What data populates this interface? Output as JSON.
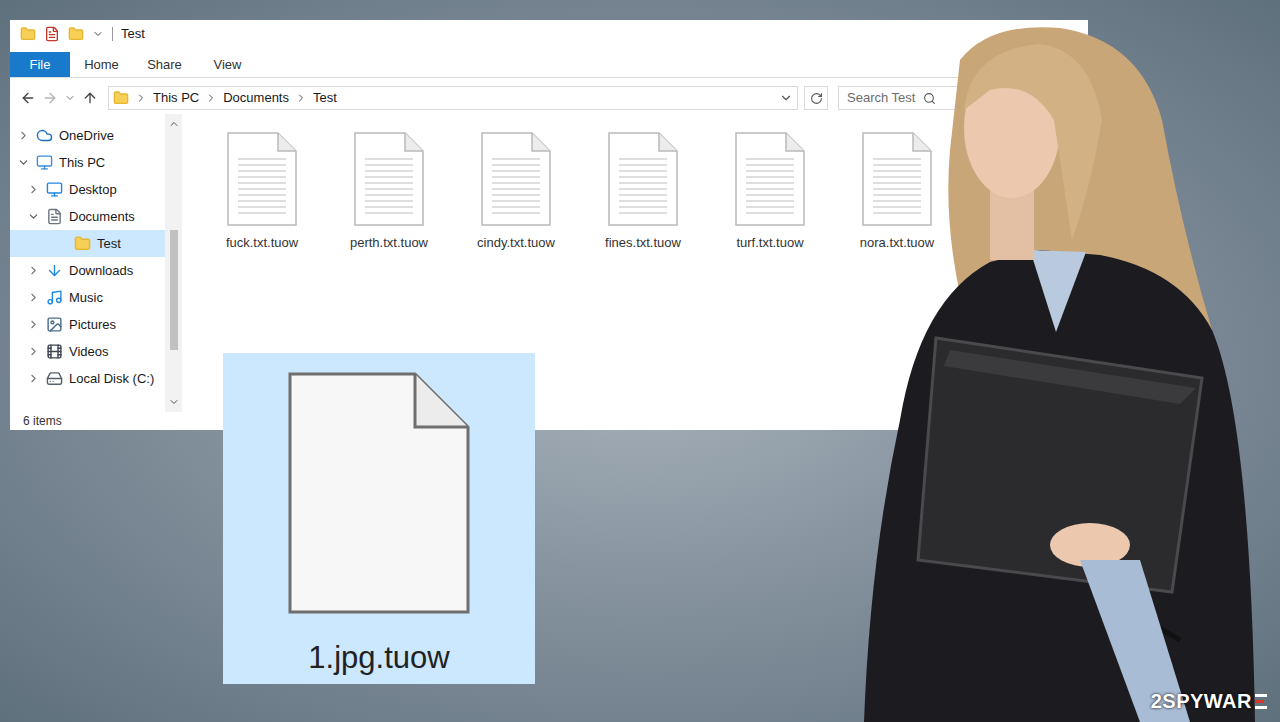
{
  "window": {
    "title": "Test"
  },
  "ribbon_tabs": [
    {
      "label": "File",
      "selected": true
    },
    {
      "label": "Home",
      "selected": false
    },
    {
      "label": "Share",
      "selected": false
    },
    {
      "label": "View",
      "selected": false
    }
  ],
  "address": {
    "crumbs": [
      "This PC",
      "Documents",
      "Test"
    ]
  },
  "search": {
    "placeholder": "Search Test"
  },
  "sidebar": {
    "items": [
      {
        "label": "OneDrive",
        "kind": "onedrive",
        "depth": 0,
        "expandable": true,
        "expanded": false,
        "selected": false
      },
      {
        "label": "This PC",
        "kind": "pc",
        "depth": 0,
        "expandable": true,
        "expanded": true,
        "selected": false
      },
      {
        "label": "Desktop",
        "kind": "desktop",
        "depth": 1,
        "expandable": true,
        "expanded": false,
        "selected": false
      },
      {
        "label": "Documents",
        "kind": "documents",
        "depth": 1,
        "expandable": true,
        "expanded": true,
        "selected": false
      },
      {
        "label": "Test",
        "kind": "folder",
        "depth": 2,
        "expandable": false,
        "expanded": false,
        "selected": true
      },
      {
        "label": "Downloads",
        "kind": "downloads",
        "depth": 1,
        "expandable": true,
        "expanded": false,
        "selected": false
      },
      {
        "label": "Music",
        "kind": "music",
        "depth": 1,
        "expandable": true,
        "expanded": false,
        "selected": false
      },
      {
        "label": "Pictures",
        "kind": "pictures",
        "depth": 1,
        "expandable": true,
        "expanded": false,
        "selected": false
      },
      {
        "label": "Videos",
        "kind": "videos",
        "depth": 1,
        "expandable": true,
        "expanded": false,
        "selected": false
      },
      {
        "label": "Local Disk (C:)",
        "kind": "disk",
        "depth": 1,
        "expandable": true,
        "expanded": false,
        "selected": false
      }
    ]
  },
  "files": [
    "fuck.txt.tuow",
    "perth.txt.tuow",
    "cindy.txt.tuow",
    "fines.txt.tuow",
    "turf.txt.tuow",
    "nora.txt.tuow"
  ],
  "status_bar": {
    "count": "6 items"
  },
  "big_icon": {
    "label": "1.jpg.tuow"
  },
  "watermark": {
    "text": "2SPYWAR"
  }
}
